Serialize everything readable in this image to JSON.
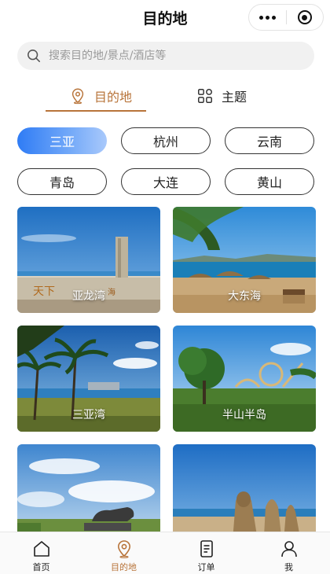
{
  "header": {
    "title": "目的地"
  },
  "search": {
    "placeholder": "搜索目的地/景点/酒店等"
  },
  "tabs": [
    {
      "label": "目的地",
      "icon": "map-pin-icon",
      "active": true
    },
    {
      "label": "主题",
      "icon": "grid-icon",
      "active": false
    }
  ],
  "cities": [
    {
      "label": "三亚",
      "active": true
    },
    {
      "label": "杭州"
    },
    {
      "label": "云南"
    },
    {
      "label": "青岛"
    },
    {
      "label": "大连"
    },
    {
      "label": "黄山"
    }
  ],
  "destinations": [
    {
      "label": "亚龙湾"
    },
    {
      "label": "大东海"
    },
    {
      "label": "三亚湾"
    },
    {
      "label": "半山半岛"
    },
    {
      "label": ""
    },
    {
      "label": ""
    }
  ],
  "tabbar": [
    {
      "label": "首页",
      "icon": "home-icon"
    },
    {
      "label": "目的地",
      "icon": "map-pin-icon",
      "active": true
    },
    {
      "label": "订单",
      "icon": "order-icon"
    },
    {
      "label": "我",
      "icon": "user-icon"
    }
  ],
  "colors": {
    "accent": "#b8743a",
    "chip_active_start": "#2f7cf5",
    "chip_active_end": "#a9c9fb"
  }
}
